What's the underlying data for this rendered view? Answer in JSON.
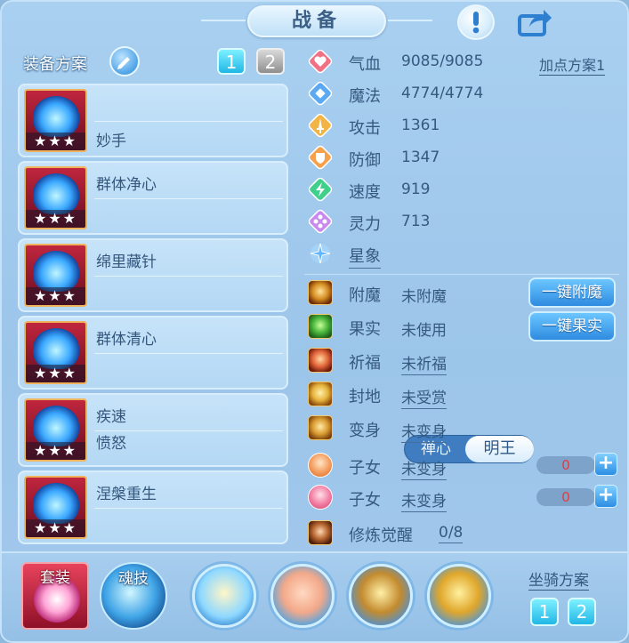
{
  "header": {
    "title": "战备"
  },
  "colors": {
    "accent": "#21b7e6",
    "text": "#36597f",
    "panel": "#a9d0f0"
  },
  "left": {
    "scheme_label": "装备方案",
    "scheme_tabs": [
      "1",
      "2"
    ],
    "skills": [
      {
        "names": [
          "",
          "妙手"
        ],
        "stars": "★★★"
      },
      {
        "names": [
          "群体净心",
          ""
        ],
        "stars": "★★★"
      },
      {
        "names": [
          "绵里藏针",
          ""
        ],
        "stars": "★★★"
      },
      {
        "names": [
          "群体清心",
          ""
        ],
        "stars": "★★★"
      },
      {
        "names": [
          "疾速",
          "愤怒"
        ],
        "stars": "★★★"
      },
      {
        "names": [
          "涅槃重生",
          ""
        ],
        "stars": "★★★"
      }
    ]
  },
  "stats": {
    "allocation_link": "加点方案1",
    "rows": [
      {
        "label": "气血",
        "value": "9085/9085",
        "icon": "heart-icon"
      },
      {
        "label": "魔法",
        "value": "4774/4774",
        "icon": "mana-icon"
      },
      {
        "label": "攻击",
        "value": "1361",
        "icon": "sword-icon"
      },
      {
        "label": "防御",
        "value": "1347",
        "icon": "shield-icon"
      },
      {
        "label": "速度",
        "value": "919",
        "icon": "speed-icon"
      },
      {
        "label": "灵力",
        "value": "713",
        "icon": "spirit-icon"
      }
    ],
    "star_sign": {
      "label": "星象",
      "options": [
        "禅心",
        "明王"
      ],
      "selected": "明王"
    }
  },
  "buffs": [
    {
      "label": "附魔",
      "value": "未附魔",
      "underline": false
    },
    {
      "label": "果实",
      "value": "未使用",
      "underline": false
    },
    {
      "label": "祈福",
      "value": "未祈福",
      "underline": true
    },
    {
      "label": "封地",
      "value": "未受赏",
      "underline": true
    },
    {
      "label": "变身",
      "value": "未变身",
      "underline": true
    },
    {
      "label": "子女",
      "value": "未变身",
      "underline": true,
      "count": "0"
    },
    {
      "label": "子女",
      "value": "未变身",
      "underline": true,
      "count": "0"
    },
    {
      "label": "修炼觉醒",
      "value": "0/8",
      "underline": true
    }
  ],
  "actions": {
    "enchant_button": "一键附魔",
    "fruit_button": "一键果实"
  },
  "bottom": {
    "suit_label": "套装",
    "soul_label": "魂技",
    "mount_label": "坐骑方案",
    "mount_tabs": [
      "1",
      "2"
    ]
  }
}
